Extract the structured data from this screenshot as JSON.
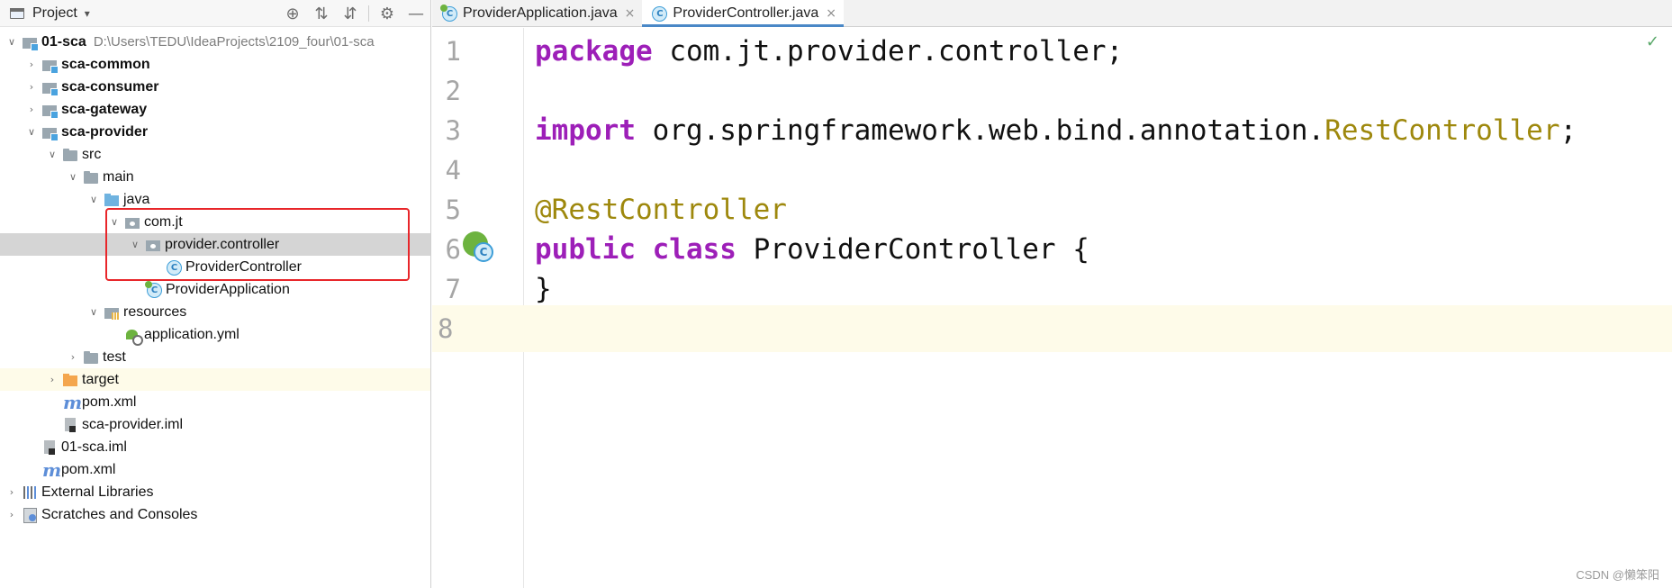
{
  "project_panel": {
    "title": "Project",
    "dropdown_glyph": "▾",
    "tools": [
      "target-icon",
      "expand-all-icon",
      "collapse-all-icon",
      "gear-icon",
      "minimize-icon"
    ],
    "tree": [
      {
        "label": "01-sca",
        "path": "D:\\Users\\TEDU\\IdeaProjects\\2109_four\\01-sca",
        "bold": true
      },
      {
        "label": "sca-common",
        "bold": true
      },
      {
        "label": "sca-consumer",
        "bold": true
      },
      {
        "label": "sca-gateway",
        "bold": true
      },
      {
        "label": "sca-provider",
        "bold": true
      },
      {
        "label": "src"
      },
      {
        "label": "main"
      },
      {
        "label": "java"
      },
      {
        "label": "com.jt"
      },
      {
        "label": "provider.controller"
      },
      {
        "label": "ProviderController"
      },
      {
        "label": "ProviderApplication"
      },
      {
        "label": "resources"
      },
      {
        "label": "application.yml"
      },
      {
        "label": "test"
      },
      {
        "label": "target"
      },
      {
        "label": "pom.xml"
      },
      {
        "label": "sca-provider.iml"
      },
      {
        "label": "01-sca.iml"
      },
      {
        "label": "pom.xml"
      },
      {
        "label": "External Libraries"
      },
      {
        "label": "Scratches and Consoles"
      }
    ]
  },
  "editor": {
    "tabs": [
      {
        "label": "ProviderApplication.java",
        "close": "×",
        "active": false
      },
      {
        "label": "ProviderController.java",
        "close": "×",
        "active": true
      }
    ],
    "line_numbers": [
      "1",
      "2",
      "3",
      "4",
      "5",
      "6",
      "7",
      "8"
    ],
    "code": {
      "l1_kw": "package",
      "l1_rest": " com.jt.provider.controller;",
      "l3_kw": "import",
      "l3_pkg": " org.springframework.web.bind.annotation.",
      "l3_cls": "RestController",
      "l3_end": ";",
      "l5_ann": "@RestController",
      "l6_kw1": "public",
      "l6_kw2": " class",
      "l6_rest": " ProviderController {",
      "l7": "}"
    },
    "inspection_glyph": "✓",
    "gutter_icon_letter": "C"
  },
  "watermark": "CSDN @懒笨阳",
  "colors": {
    "keyword": "#9d1fb8",
    "annotation": "#9e880d",
    "highlight_box": "#e8262a",
    "selection": "#d5d5d5",
    "current_line": "#fefbe9"
  }
}
